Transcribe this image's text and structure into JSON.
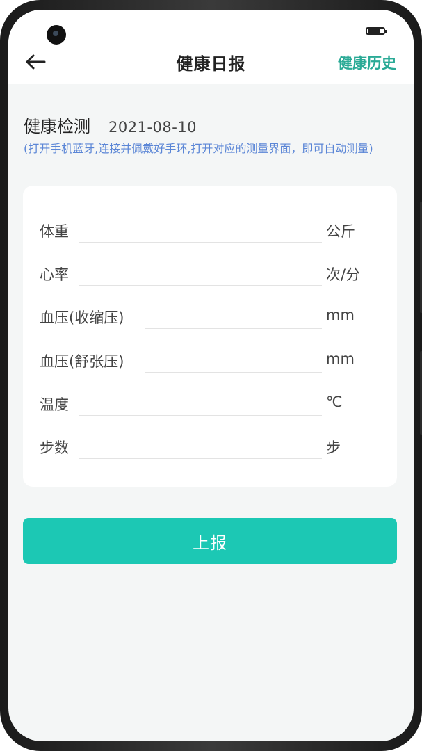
{
  "header": {
    "title": "健康日报",
    "history_link": "健康历史"
  },
  "section": {
    "title": "健康检测",
    "date": "2021-08-10",
    "hint": "(打开手机蓝牙,连接并佩戴好手环,打开对应的测量界面，即可自动测量)"
  },
  "form": {
    "rows": [
      {
        "label": "体重",
        "value": "",
        "unit": "公斤"
      },
      {
        "label": "心率",
        "value": "",
        "unit": "次/分"
      },
      {
        "label": "血压(收缩压)",
        "value": "",
        "unit": "mm"
      },
      {
        "label": "血压(舒张压)",
        "value": "",
        "unit": "mm"
      },
      {
        "label": "温度",
        "value": "",
        "unit": "℃"
      },
      {
        "label": "步数",
        "value": "",
        "unit": "步"
      }
    ]
  },
  "submit_label": "上报",
  "colors": {
    "accent": "#1cc8b4",
    "link": "#2aaa96",
    "hint": "#5b86d6",
    "background": "#f4f6f6"
  },
  "icons": {
    "back": "back-arrow-icon",
    "battery": "battery-icon",
    "camera": "front-camera"
  }
}
